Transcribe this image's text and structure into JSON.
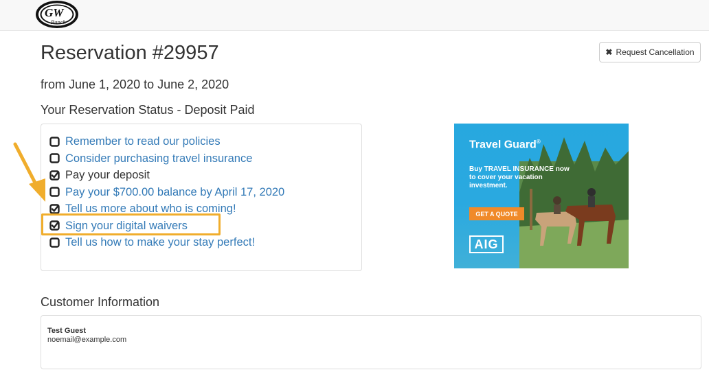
{
  "header": {
    "logo_text": "GW Ranch"
  },
  "reservation": {
    "title": "Reservation #29957",
    "date_range": "from June 1, 2020 to June 2, 2020",
    "status_heading": "Your Reservation Status - Deposit Paid",
    "cancel_button_label": "Request Cancellation",
    "cancel_icon": "times-icon"
  },
  "checklist": [
    {
      "label": "Remember to read our policies",
      "checked": false,
      "link": true
    },
    {
      "label": "Consider purchasing travel insurance",
      "checked": false,
      "link": true
    },
    {
      "label": "Pay your deposit",
      "checked": true,
      "link": false
    },
    {
      "label": "Pay your $700.00 balance by April 17, 2020",
      "checked": false,
      "link": true
    },
    {
      "label": "Tell us more about who is coming!",
      "checked": true,
      "link": true
    },
    {
      "label": "Sign your digital waivers",
      "checked": true,
      "link": true
    },
    {
      "label": "Tell us how to make your stay perfect!",
      "checked": false,
      "link": true
    }
  ],
  "annotation": {
    "highlighted_item": "Sign your digital waivers",
    "highlight_color": "#f0ad2c"
  },
  "ad": {
    "brand": "Travel Guard",
    "brand_mark": "®",
    "tagline": "Buy TRAVEL INSURANCE now to cover your vacation investment.",
    "cta": "GET A QUOTE",
    "sponsor": "AIG"
  },
  "customer": {
    "heading": "Customer Information",
    "name": "Test Guest",
    "email": "noemail@example.com"
  },
  "colors": {
    "link": "#337ab7",
    "text": "#333333",
    "ad_blue": "#27a8df",
    "ad_cta": "#f08a29"
  }
}
